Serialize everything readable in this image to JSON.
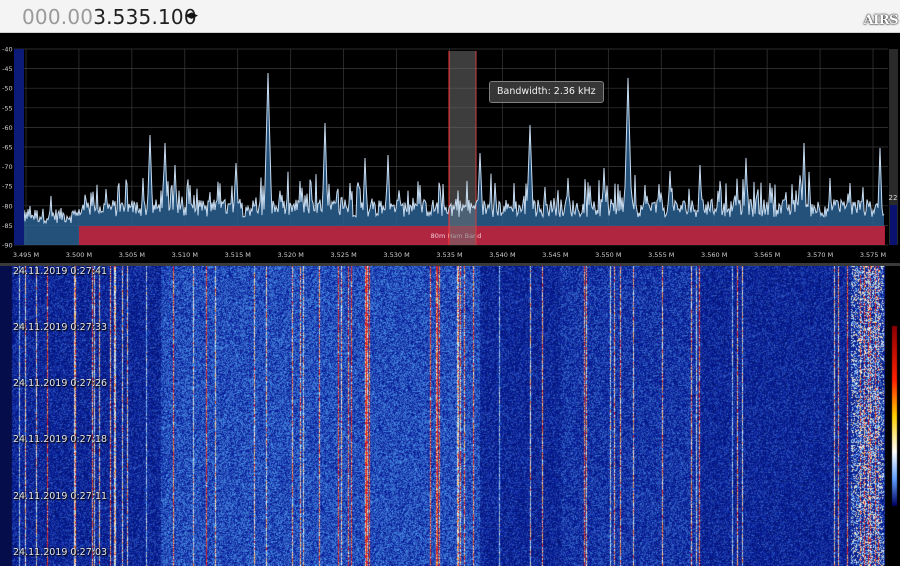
{
  "frequency": {
    "dim_digits": "000.00",
    "bright_digits": "3.535.100",
    "arrows": "◂▸"
  },
  "logo": "AIRS",
  "bandwidth_label": "Bandwidth: 2.36 kHz",
  "band_label": "80m Ham Band",
  "gain_value": "22",
  "spectrum_axis": {
    "db_ticks": [
      "-40",
      "-45",
      "-50",
      "-55",
      "-60",
      "-65",
      "-70",
      "-75",
      "-80",
      "-85",
      "-90"
    ],
    "freq_ticks": [
      "3.495 M",
      "3.500 M",
      "3.505 M",
      "3.510 M",
      "3.515 M",
      "3.520 M",
      "3.525 M",
      "3.530 M",
      "3.535 M",
      "3.540 M",
      "3.545 M",
      "3.550 M",
      "3.555 M",
      "3.560 M",
      "3.565 M",
      "3.570 M",
      "3.575 M"
    ]
  },
  "timestamps": [
    "24.11.2019 0:27:41",
    "24.11.2019 0:27:33",
    "24.11.2019 0:27:26",
    "24.11.2019 0:27:18",
    "24.11.2019 0:27:11",
    "24.11.2019 0:27:03"
  ],
  "colors": {
    "band": "#c0203a",
    "spectrum_fill": "#2a5f8f",
    "trace": "#c8dcf0",
    "selection": "#6e6e6e",
    "center_line": "#ff3030"
  }
}
